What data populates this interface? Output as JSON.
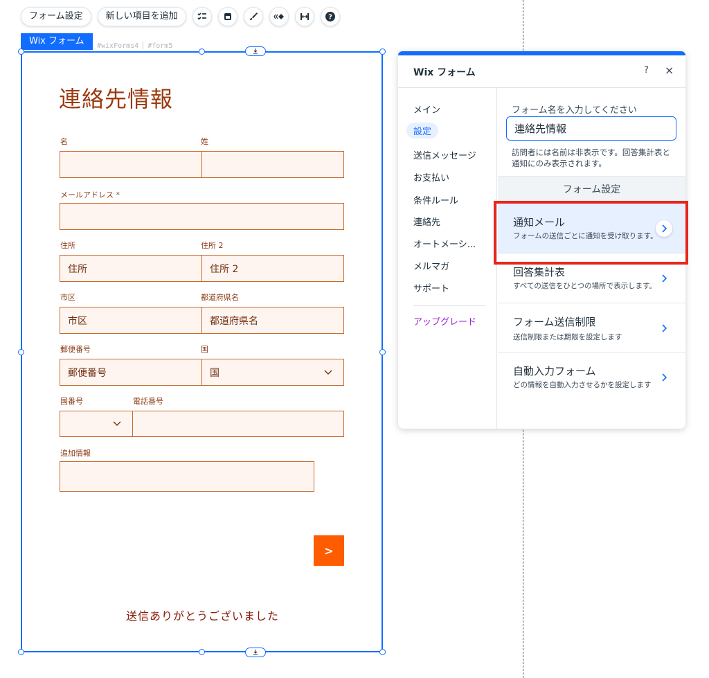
{
  "toolbar": {
    "form_settings_label": "フォーム設定",
    "add_item_label": "新しい項目を追加",
    "icons": [
      "checklist-icon",
      "layout-icon",
      "paint-brush-icon",
      "animation-icon",
      "stretch-icon",
      "help-icon"
    ]
  },
  "component": {
    "tag": "Wix フォーム",
    "id_1": "#wixForms4",
    "id_2": "#form5"
  },
  "form": {
    "title": "連絡先情報",
    "fields": {
      "first_name": {
        "label": "名",
        "placeholder": ""
      },
      "last_name": {
        "label": "姓",
        "placeholder": ""
      },
      "email": {
        "label": "メールアドレス *",
        "placeholder": ""
      },
      "address": {
        "label": "住所",
        "placeholder": "住所"
      },
      "address2": {
        "label": "住所 2",
        "placeholder": "住所 2"
      },
      "city": {
        "label": "市区",
        "placeholder": "市区"
      },
      "prefecture": {
        "label": "都道府県名",
        "placeholder": "都道府県名"
      },
      "postal": {
        "label": "郵便番号",
        "placeholder": "郵便番号"
      },
      "country": {
        "label": "国",
        "placeholder": "国"
      },
      "country_code": {
        "label": "国番号",
        "placeholder": ""
      },
      "phone": {
        "label": "電話番号",
        "placeholder": ""
      },
      "additional": {
        "label": "追加情報",
        "placeholder": ""
      }
    },
    "submit_label": ">",
    "thanks_message": "送信ありがとうございました"
  },
  "panel": {
    "title": "Wix フォーム",
    "help": "?",
    "close": "×",
    "nav": [
      {
        "label": "メイン",
        "active": false
      },
      {
        "label": "設定",
        "active": true
      },
      {
        "label": "送信メッセージ",
        "active": false
      },
      {
        "label": "お支払い",
        "active": false
      },
      {
        "label": "条件ルール",
        "active": false
      },
      {
        "label": "連絡先",
        "active": false
      },
      {
        "label": "オートメーシ...",
        "active": false
      },
      {
        "label": "メルマガ",
        "active": false
      },
      {
        "label": "サポート",
        "active": false
      }
    ],
    "upgrade": "アップグレード",
    "name_label": "フォーム名を入力してください",
    "name_value": "連絡先情報",
    "name_hint": "訪問者には名前は非表示です。回答集計表と通知にのみ表示されます。",
    "section_title": "フォーム設定",
    "settings": [
      {
        "title": "通知メール",
        "desc": "フォームの送信ごとに通知を受け取ります。",
        "highlighted": true
      },
      {
        "title": "回答集計表",
        "desc": "すべての送信をひとつの場所で表示します。",
        "highlighted": false
      },
      {
        "title": "フォーム送信制限",
        "desc": "送信制限または期限を設定します",
        "highlighted": false
      },
      {
        "title": "自動入力フォーム",
        "desc": "どの情報を自動入力させるかを設定します",
        "highlighted": false
      }
    ]
  },
  "colors": {
    "selection": "#116dff",
    "form_text": "#9c3a0f",
    "field_border": "#c8692c",
    "field_fill": "#fff5f0",
    "submit": "#ff5c00",
    "upgrade": "#9a27d5",
    "annotation": "#e8271c"
  }
}
